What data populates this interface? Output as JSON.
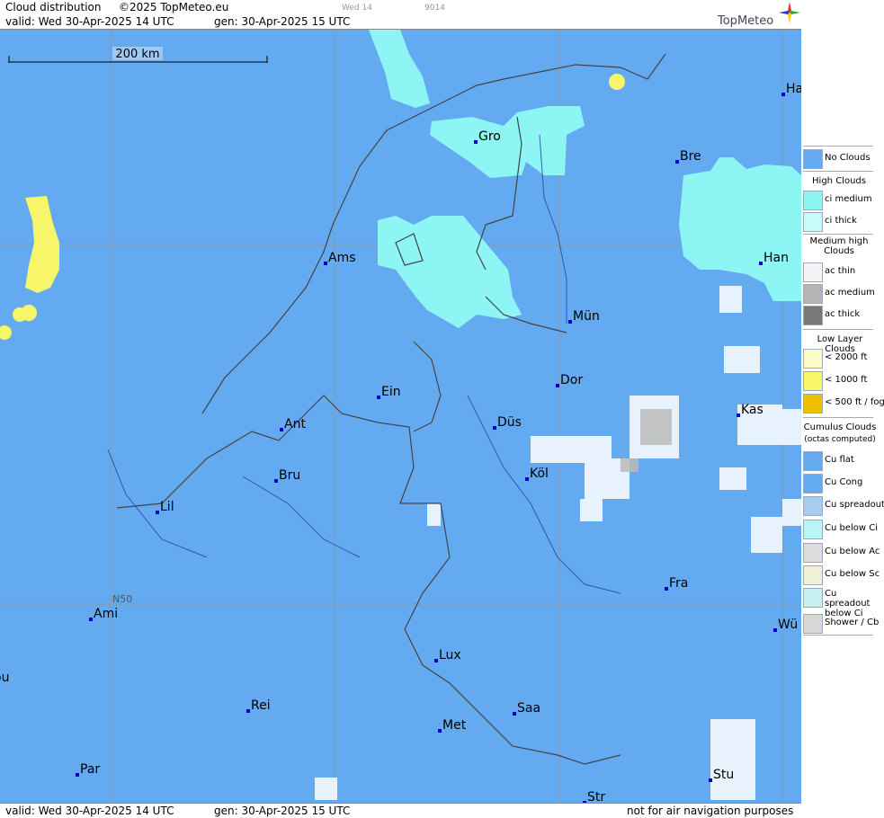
{
  "header": {
    "product": "Cloud distribution",
    "copyright": "©2025 TopMeteo.eu",
    "timeslot": "Wed 14",
    "code": "9014",
    "valid": "valid:  Wed  30-Apr-2025  14 UTC",
    "generated": "gen: 30-Apr-2025 15 UTC",
    "logo": "TopMeteo"
  },
  "footer": {
    "valid": "valid:  Wed  30-Apr-2025  14 UTC",
    "generated": "gen: 30-Apr-2025 15 UTC",
    "disclaimer": "not for air navigation purposes"
  },
  "map": {
    "scale_label": "200 km",
    "lat_label": "N50",
    "cities": [
      "Ha",
      "Gro",
      "Bre",
      "Ams",
      "Han",
      "Mün",
      "Dor",
      "Ein",
      "Kas",
      "Ant",
      "Düs",
      "Bru",
      "Köl",
      "Lil",
      "Fra",
      "Ami",
      "Wü",
      "Lux",
      "ou",
      "Rei",
      "Saa",
      "Met",
      "Par",
      "Stu",
      "Str"
    ]
  },
  "legend": {
    "no_clouds": "No Clouds",
    "high_title": "High Clouds",
    "ci_medium": "ci medium",
    "ci_thick": "ci thick",
    "medium_title": "Medium high Clouds",
    "ac_thin": "ac thin",
    "ac_medium": "ac medium",
    "ac_thick": "ac thick",
    "low_title": "Low Layer Clouds",
    "low_2000": "< 2000 ft",
    "low_1000": "< 1000 ft",
    "low_500": "< 500 ft / fog",
    "cu_title": "Cumulus Clouds",
    "cu_sub": "(octas computed)",
    "cu_flat": "Cu flat",
    "cu_cong": "Cu Cong",
    "cu_spreadout": "Cu spreadout",
    "cu_below_ci": "Cu below Ci",
    "cu_below_ac": "Cu below Ac",
    "cu_below_sc": "Cu below Sc",
    "cu_spreadout_ci": "Cu spreadout below Ci",
    "shower": "Shower / Cb"
  },
  "colors": {
    "no_clouds": "#64aaf0",
    "ci": "#8ef5f5",
    "low_1000": "#f7f56a",
    "fog": "#f0c000",
    "cu": "#ffffff"
  }
}
